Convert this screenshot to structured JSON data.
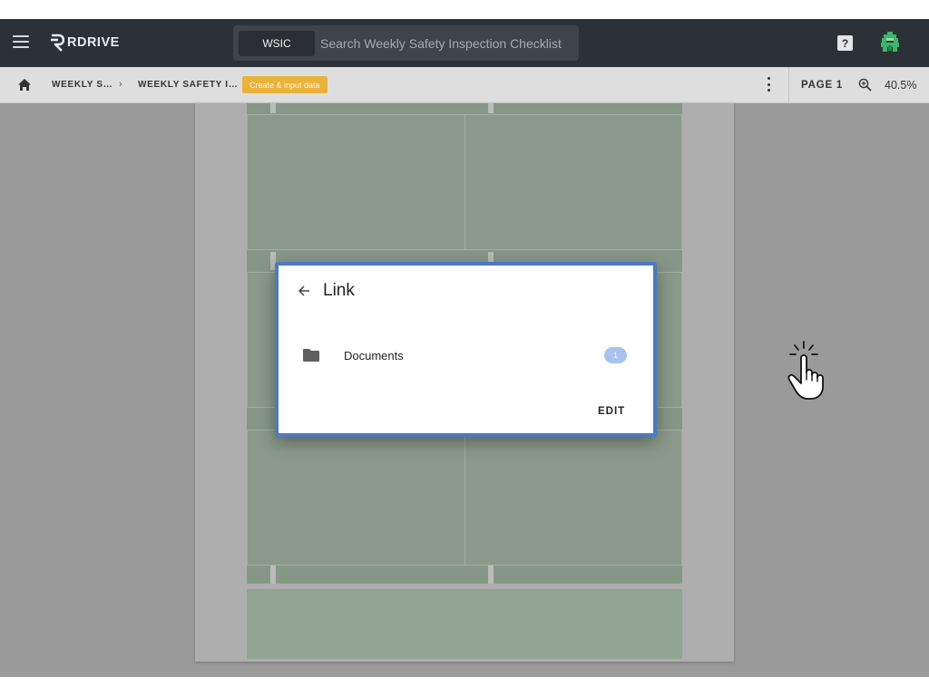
{
  "appbar": {
    "logo_text": "RDRIVE",
    "search": {
      "chip": "WSIC",
      "placeholder": "Search Weekly Safety Inspection Checklist"
    },
    "help_glyph": "?"
  },
  "breadcrumb": {
    "items": [
      "WEEKLY S…",
      "WEEKLY SAFETY I…"
    ],
    "separator": "›",
    "action_label": "Create & input data",
    "page_label": "PAGE 1",
    "zoom_level": "40.5%"
  },
  "dialog": {
    "title": "Link",
    "rows": [
      {
        "label": "Documents",
        "count": "1",
        "icon": "folder-icon"
      }
    ],
    "edit_label": "EDIT"
  },
  "icons": {
    "menu": "menu-icon",
    "home": "home-icon",
    "more": "more-vertical-icon",
    "zoom": "zoom-in-icon",
    "back": "arrow-left-icon",
    "help": "help-icon",
    "avatar": "avatar",
    "cursor": "tap-pointer-icon"
  },
  "colors": {
    "appbar": "#2c3037",
    "accent_badge": "#e9b23a",
    "dialog_border": "#4d79c2",
    "count_badge": "#a9c2ee",
    "avatar_green": "#3fb56b"
  }
}
